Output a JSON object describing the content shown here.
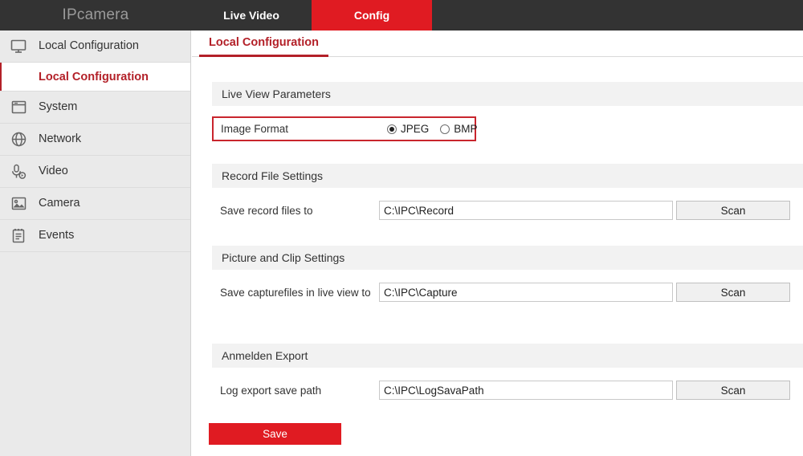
{
  "header": {
    "brand": "IPcamera",
    "tabs": [
      {
        "label": "Live Video",
        "active": false
      },
      {
        "label": "Config",
        "active": true
      }
    ],
    "active_color": "#e01b22",
    "bar_color": "#333333"
  },
  "sidebar": {
    "items": [
      {
        "label": "Local Configuration",
        "icon": "monitor-icon"
      },
      {
        "label": "System",
        "icon": "window-icon"
      },
      {
        "label": "Network",
        "icon": "globe-icon"
      },
      {
        "label": "Video",
        "icon": "microphone-play-icon"
      },
      {
        "label": "Camera",
        "icon": "image-icon"
      },
      {
        "label": "Events",
        "icon": "clipboard-icon"
      }
    ],
    "sub_item": {
      "label": "Local Configuration",
      "active": true
    },
    "accent_color": "#b32028"
  },
  "content": {
    "tab": {
      "label": "Local Configuration"
    },
    "sections": [
      {
        "title": "Live View Parameters"
      },
      {
        "title": "Record File Settings"
      },
      {
        "title": "Picture and Clip Settings"
      },
      {
        "title": "Anmelden Export"
      }
    ],
    "image_format": {
      "label": "Image Format",
      "options": [
        {
          "label": "JPEG",
          "checked": true
        },
        {
          "label": "BMP",
          "checked": false
        }
      ],
      "highlight_color": "#c9252d"
    },
    "rows": [
      {
        "label": "Save record files to",
        "value": "C:\\IPC\\Record",
        "placeholder": "",
        "button": "Scan"
      },
      {
        "label": "Save capturefiles in live view to",
        "value": "C:\\IPC\\Capture",
        "placeholder": "",
        "button": "Scan"
      },
      {
        "label": "Log export save path",
        "value": "C:\\IPC\\LogSavaPath",
        "placeholder": "",
        "button": "Scan"
      }
    ],
    "save_button": {
      "label": "Save",
      "color": "#e01b22"
    }
  }
}
